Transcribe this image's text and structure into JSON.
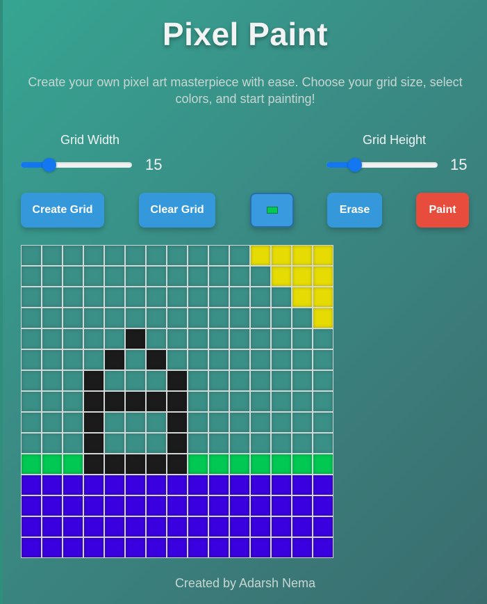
{
  "header": {
    "title": "Pixel Paint",
    "subtitle": "Create your own pixel art masterpiece with ease. Choose your grid size, select colors, and start painting!"
  },
  "controls": {
    "width": {
      "label": "Grid Width",
      "value": "15",
      "min": 5,
      "max": 50
    },
    "height": {
      "label": "Grid Height",
      "value": "15",
      "min": 5,
      "max": 50
    }
  },
  "toolbar": {
    "create_label": "Create Grid",
    "clear_label": "Clear Grid",
    "selected_color": "#00c853",
    "erase_label": "Erase",
    "paint_label": "Paint"
  },
  "colors": {
    "e": "#3a8f86",
    "y": "#e6dc04",
    "k": "#1b1b1b",
    "g": "#00c853",
    "b": "#3a00e0"
  },
  "grid": {
    "rows": [
      "eeeeeeeeeeeyyyy",
      "eeeeeeeeeeeeyyy",
      "eeeeeeeeeeeeeyy",
      "eeeeeeeeeeeeeey",
      "eeeeekeeeeeeeee",
      "eeeekekeeeeeeee",
      "eeekeeekeeeeeee",
      "eeekkkkkeeeeeee",
      "eeekeeekeeeeeee",
      "eeekeeekeeeeeee",
      "ggg",
      "bbbbbbbbbbbbbbb",
      "bbbbbbbbbbbbbbb",
      "bbbbbbbbbbbbbbb",
      "bbbbbbbbbbbbbbb"
    ]
  },
  "footer": {
    "credit": "Created by Adarsh Nema"
  }
}
